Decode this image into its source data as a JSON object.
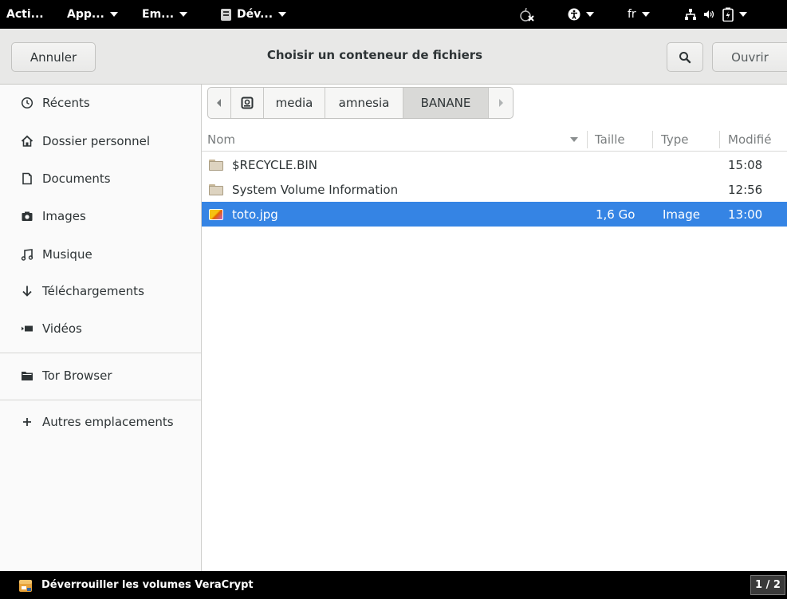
{
  "top_panel": {
    "activities": "Acti...",
    "applications": "App...",
    "places": "Em...",
    "current_app": "Dév...",
    "language": "fr"
  },
  "header": {
    "cancel_label": "Annuler",
    "title": "Choisir un conteneur de fichiers",
    "open_label": "Ouvrir"
  },
  "sidebar": {
    "items": [
      {
        "label": "Récents",
        "icon": "clock-icon"
      },
      {
        "label": "Dossier personnel",
        "icon": "home-icon"
      },
      {
        "label": "Documents",
        "icon": "document-icon"
      },
      {
        "label": "Images",
        "icon": "camera-icon"
      },
      {
        "label": "Musique",
        "icon": "music-icon"
      },
      {
        "label": "Téléchargements",
        "icon": "download-icon"
      },
      {
        "label": "Vidéos",
        "icon": "video-icon"
      },
      {
        "label": "Tor Browser",
        "icon": "folder-icon"
      },
      {
        "label": "Autres emplacements",
        "icon": "plus-icon"
      }
    ]
  },
  "pathbar": {
    "segments": [
      "media",
      "amnesia",
      "BANANE"
    ],
    "active": "BANANE"
  },
  "columns": {
    "name": "Nom",
    "size": "Taille",
    "type": "Type",
    "modified": "Modifié"
  },
  "files": [
    {
      "name": "$RECYCLE.BIN",
      "size": "",
      "type": "",
      "modified": "15:08",
      "icon": "folder-icon",
      "selected": false
    },
    {
      "name": "System Volume Information",
      "size": "",
      "type": "",
      "modified": "12:56",
      "icon": "folder-icon",
      "selected": false
    },
    {
      "name": "toto.jpg",
      "size": "1,6 Go",
      "type": "Image",
      "modified": "13:00",
      "icon": "image-file-icon",
      "selected": true
    }
  ],
  "taskbar": {
    "window_label": "Déverrouiller les volumes VeraCrypt",
    "workspace": "1 / 2"
  },
  "colors": {
    "selection": "#3584e4",
    "panel": "#000000",
    "headerbar": "#e8e8e7",
    "sidebar": "#fafafa"
  }
}
